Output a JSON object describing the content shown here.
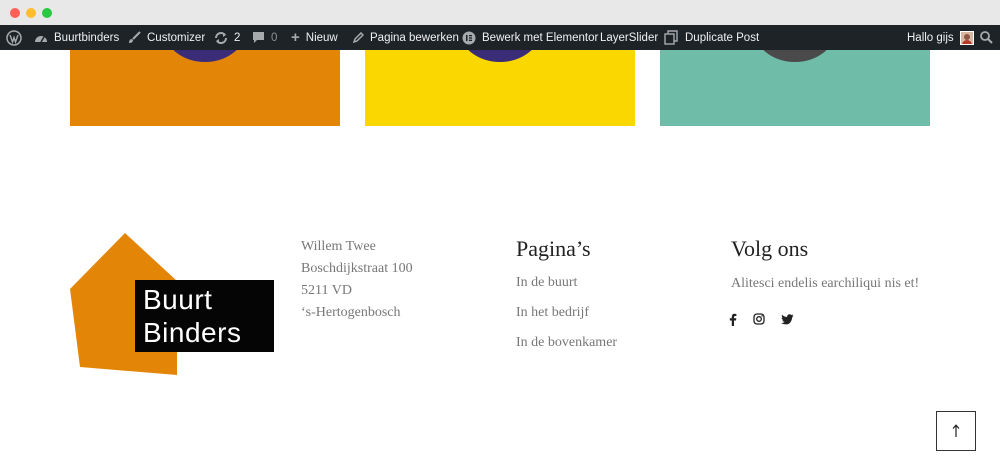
{
  "window": {
    "controls": [
      "close",
      "minimize",
      "zoom"
    ]
  },
  "adminbar": {
    "wp_logo_icon": "wordpress-icon",
    "site_name": "Buurtbinders",
    "customizer": "Customizer",
    "updates_count": "2",
    "comments_count": "0",
    "new_label": "Nieuw",
    "edit_page": "Pagina bewerken",
    "elementor": "Bewerk met Elementor",
    "layerslider": "LayerSlider",
    "duplicate": "Duplicate Post",
    "greeting": "Hallo gijs"
  },
  "colors": {
    "orange": "#e38608",
    "yellow": "#fbd700",
    "teal": "#6fbca8",
    "navy": "#3b2c78",
    "adminbar_bg": "#1d2327"
  },
  "logo": {
    "line1": "Buurt",
    "line2": "Binders"
  },
  "address": {
    "name": "Willem Twee",
    "street": "Boschdijkstraat 100",
    "postal": "5211 VD",
    "city": "‘s-Hertogenbosch"
  },
  "pages": {
    "title": "Pagina’s",
    "items": [
      "In de buurt",
      "In het bedrijf",
      "In de bovenkamer"
    ]
  },
  "follow": {
    "title": "Volg ons",
    "text": "Alitesci endelis earchiliqui nis et!",
    "icons": [
      "facebook-icon",
      "instagram-icon",
      "twitter-icon"
    ]
  },
  "to_top_icon": "arrow-up-icon"
}
